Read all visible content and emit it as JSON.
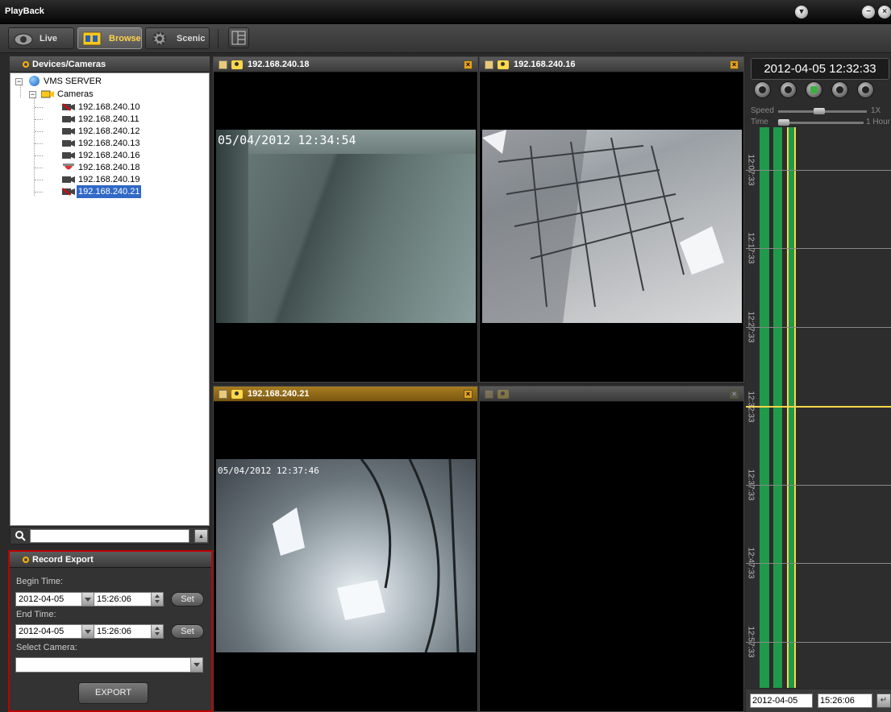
{
  "window": {
    "title": "PlayBack",
    "btn_menu": "▾",
    "btn_min": "−",
    "btn_close": "×"
  },
  "toolbar": {
    "tabs": [
      {
        "label": "Live",
        "active": false
      },
      {
        "label": "Browse",
        "active": true
      },
      {
        "label": "Scenic",
        "active": false
      }
    ]
  },
  "devices": {
    "header": "Devices/Cameras",
    "server": "VMS SERVER",
    "group": "Cameras",
    "cameras": [
      {
        "label": "192.168.240.10",
        "status": "offline"
      },
      {
        "label": "192.168.240.11",
        "status": "online"
      },
      {
        "label": "192.168.240.12",
        "status": "online"
      },
      {
        "label": "192.168.240.13",
        "status": "online"
      },
      {
        "label": "192.168.240.16",
        "status": "online"
      },
      {
        "label": "192.168.240.18",
        "status": "dome"
      },
      {
        "label": "192.168.240.19",
        "status": "online"
      },
      {
        "label": "192.168.240.21",
        "status": "offline",
        "selected": true
      }
    ],
    "search_placeholder": ""
  },
  "export": {
    "header": "Record Export",
    "begin_label": "Begin Time:",
    "begin_date": "2012-04-05",
    "begin_time": "15:26:06",
    "end_label": "End Time:",
    "end_date": "2012-04-05",
    "end_time": "15:26:06",
    "set_label": "Set",
    "camera_label": "Select Camera:",
    "camera_value": "",
    "export_label": "EXPORT"
  },
  "cells": [
    {
      "title": "192.168.240.18",
      "osd": "05/04/2012 12:34:54",
      "active": false
    },
    {
      "title": "192.168.240.16",
      "osd": "",
      "active": false
    },
    {
      "title": "192.168.240.21",
      "osd": "05/04/2012  12:37:46",
      "active": true
    },
    {
      "title": "",
      "osd": "",
      "active": false
    }
  ],
  "timeline": {
    "clock": "2012-04-05 12:32:33",
    "speed_label": "Speed",
    "speed_value": "1X",
    "time_label": "Time",
    "time_value": "1 Hour",
    "ticks": [
      "12:07:33",
      "12:17:33",
      "12:27:33",
      "12:32:33",
      "12:37:33",
      "12:47:33",
      "12:57:33"
    ],
    "date": "2012-04-05",
    "time": "15:26:06",
    "colors": {
      "record": "#1f9a4a",
      "cursor": "#ffd84a"
    }
  }
}
